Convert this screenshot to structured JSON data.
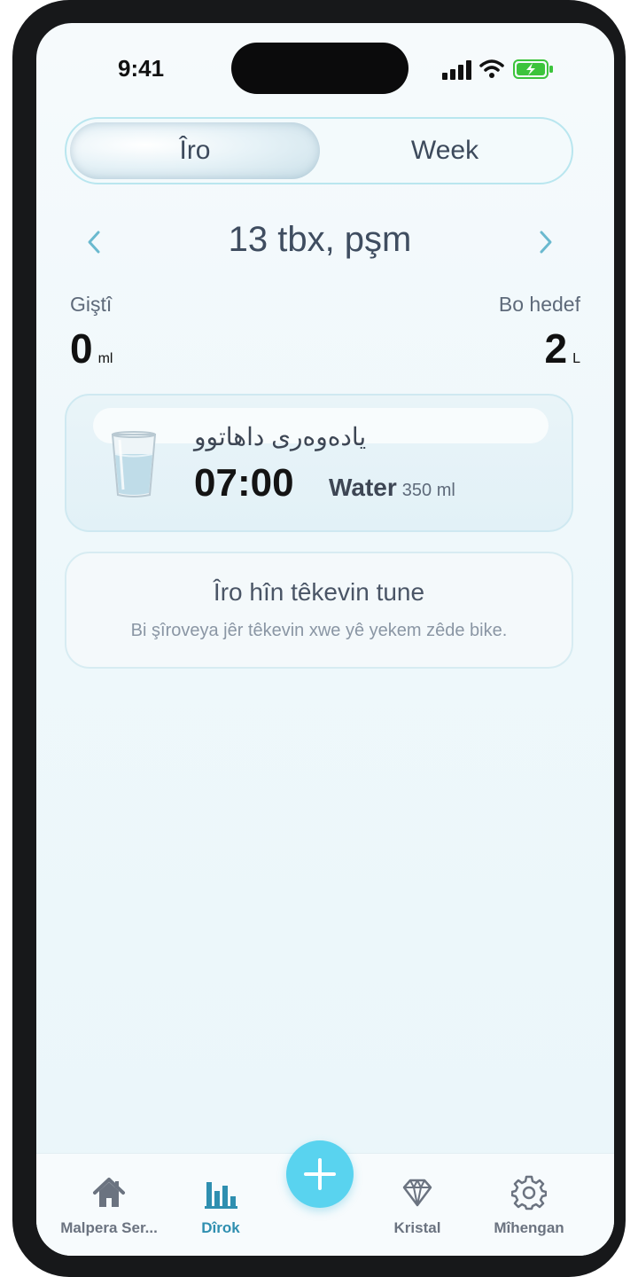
{
  "status_bar": {
    "time": "9:41"
  },
  "segment": {
    "today_label": "Îro",
    "week_label": "Week"
  },
  "date_nav": {
    "title": "13 tbx, pşm"
  },
  "stats": {
    "total_label": "Giştî",
    "total_value": "0",
    "total_unit": "ml",
    "goal_label": "Bo hedef",
    "goal_value": "2",
    "goal_unit": "L"
  },
  "reminder": {
    "title": "یادەوەری داهاتوو",
    "time": "07:00",
    "drink": "Water",
    "amount": "350 ml",
    "icon": "water-glass-icon"
  },
  "empty_state": {
    "title": "Îro hîn têkevin tune",
    "subtitle": "Bi şîroveya jêr têkevin xwe yê yekem zêde bike."
  },
  "tabbar": {
    "items": [
      {
        "label": "Malpera Ser...",
        "icon": "home-icon"
      },
      {
        "label": "Dîrok",
        "icon": "bar-chart-icon",
        "active": true
      },
      {
        "label": "Kristal",
        "icon": "diamond-icon"
      },
      {
        "label": "Mîhengan",
        "icon": "gear-icon"
      }
    ],
    "fab_icon": "plus-icon"
  },
  "colors": {
    "accent": "#59d3ef",
    "active_tab": "#2f8fb0",
    "arrow": "#6ab9cf"
  }
}
